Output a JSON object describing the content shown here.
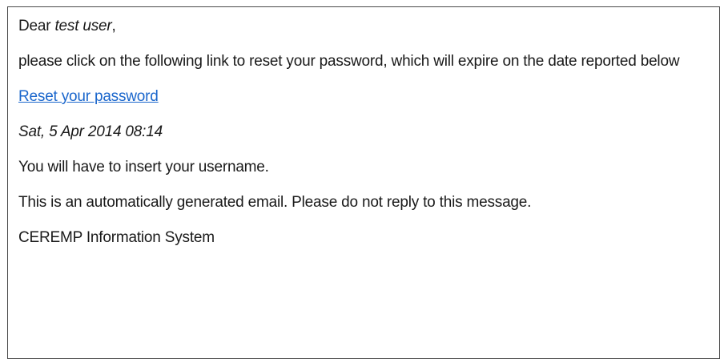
{
  "email": {
    "greeting_prefix": "Dear ",
    "recipient_name": "test user",
    "greeting_suffix": ",",
    "intro": "please click on the following link to reset your password, which will expire on the date reported below",
    "reset_link_label": "Reset your password",
    "expiry_date": "Sat, 5 Apr 2014 08:14",
    "username_note": "You will have to insert your username.",
    "auto_note": "This is an automatically generated email. Please do not reply to this message.",
    "signature": "CEREMP Information System"
  },
  "colors": {
    "link": "#1a66cc",
    "text": "#1a1a1a",
    "border": "#4a4a4a"
  }
}
